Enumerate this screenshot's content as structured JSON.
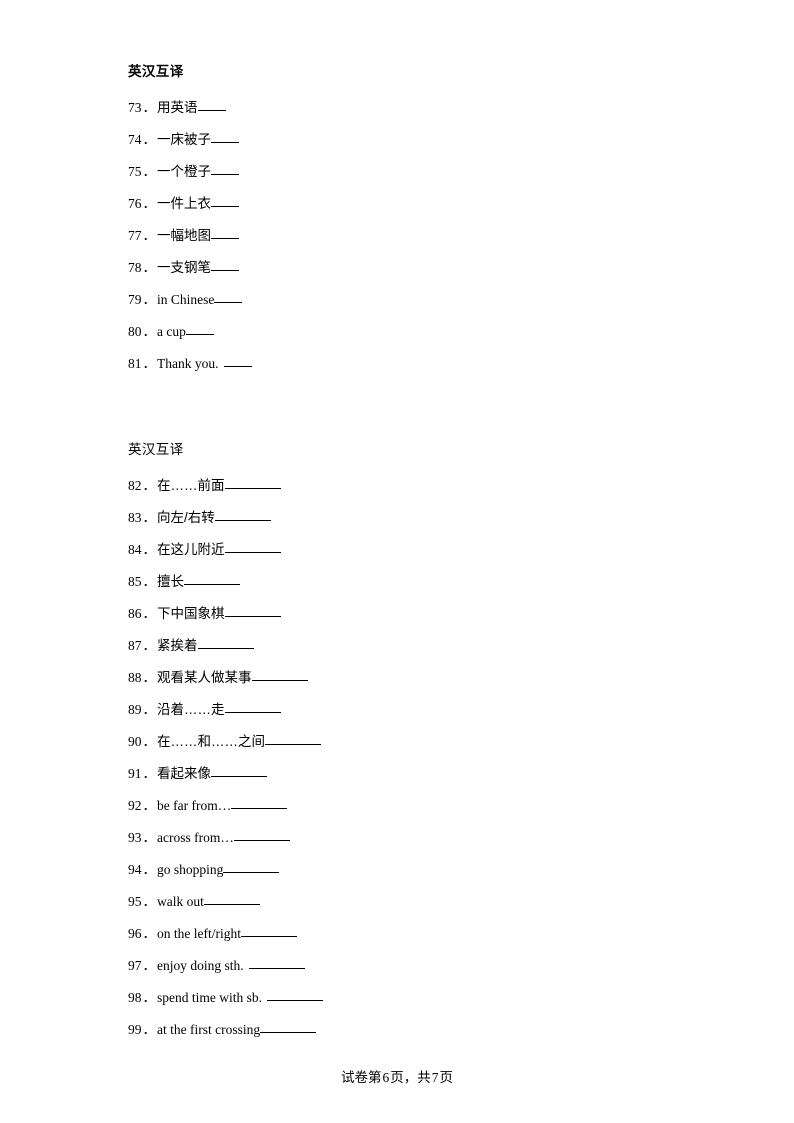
{
  "document": {
    "page_label": "试卷第 6 页，共 7 页",
    "footer": {
      "prefix": "试卷第",
      "current_page": "6",
      "middle": "页，共",
      "total_pages": "7",
      "suffix": "页"
    }
  },
  "sections": [
    {
      "heading": "英汉互译",
      "heading_bold": true,
      "blank_style": "short",
      "items": [
        {
          "number": "73",
          "sep": "．",
          "text": "用英语",
          "lang": "cn",
          "trailing_space": false
        },
        {
          "number": "74",
          "sep": "．",
          "text": "一床被子",
          "lang": "cn",
          "trailing_space": false
        },
        {
          "number": "75",
          "sep": "．",
          "text": "一个橙子",
          "lang": "cn",
          "trailing_space": false
        },
        {
          "number": "76",
          "sep": "．",
          "text": "一件上衣",
          "lang": "cn",
          "trailing_space": false
        },
        {
          "number": "77",
          "sep": "．",
          "text": "一幅地图",
          "lang": "cn",
          "trailing_space": false
        },
        {
          "number": "78",
          "sep": "．",
          "text": "一支钢笔",
          "lang": "cn",
          "trailing_space": false
        },
        {
          "number": "79",
          "sep": "．",
          "text": "in Chinese",
          "lang": "en",
          "trailing_space": false
        },
        {
          "number": "80",
          "sep": "．",
          "text": "a cup",
          "lang": "en",
          "trailing_space": false
        },
        {
          "number": "81",
          "sep": "．",
          "text": "Thank you.",
          "lang": "en",
          "trailing_space": true
        }
      ]
    },
    {
      "heading": "英汉互译",
      "heading_bold": false,
      "blank_style": "long",
      "items": [
        {
          "number": "82",
          "sep": "．",
          "text": "在……前面",
          "lang": "cn",
          "trailing_space": false
        },
        {
          "number": "83",
          "sep": "．",
          "text": "向左/右转",
          "lang": "cn",
          "trailing_space": false
        },
        {
          "number": "84",
          "sep": "．",
          "text": "在这儿附近",
          "lang": "cn",
          "trailing_space": false
        },
        {
          "number": "85",
          "sep": "．",
          "text": "擅长",
          "lang": "cn",
          "trailing_space": false
        },
        {
          "number": "86",
          "sep": "．",
          "text": "下中国象棋",
          "lang": "cn",
          "trailing_space": false
        },
        {
          "number": "87",
          "sep": "．",
          "text": "紧挨着",
          "lang": "cn",
          "trailing_space": false
        },
        {
          "number": "88",
          "sep": "．",
          "text": "观看某人做某事",
          "lang": "cn",
          "trailing_space": false
        },
        {
          "number": "89",
          "sep": "．",
          "text": "沿着……走",
          "lang": "cn",
          "trailing_space": false
        },
        {
          "number": "90",
          "sep": "．",
          "text": "在……和……之间",
          "lang": "cn",
          "trailing_space": false
        },
        {
          "number": "91",
          "sep": "．",
          "text": "看起来像",
          "lang": "cn",
          "trailing_space": false
        },
        {
          "number": "92",
          "sep": "．",
          "text": "be far from…",
          "lang": "en",
          "trailing_space": false
        },
        {
          "number": "93",
          "sep": "．",
          "text": "across from…",
          "lang": "en",
          "trailing_space": false
        },
        {
          "number": "94",
          "sep": "．",
          "text": "go shopping",
          "lang": "en",
          "trailing_space": false
        },
        {
          "number": "95",
          "sep": "．",
          "text": "walk out",
          "lang": "en",
          "trailing_space": false
        },
        {
          "number": "96",
          "sep": "．",
          "text": "on the left/right",
          "lang": "en",
          "trailing_space": false
        },
        {
          "number": "97",
          "sep": "．",
          "text": "enjoy doing sth.",
          "lang": "en",
          "trailing_space": true
        },
        {
          "number": "98",
          "sep": "．",
          "text": "spend time with sb.",
          "lang": "en",
          "trailing_space": true
        },
        {
          "number": "99",
          "sep": "．",
          "text": "at the first crossing",
          "lang": "en",
          "trailing_space": false
        }
      ]
    }
  ]
}
